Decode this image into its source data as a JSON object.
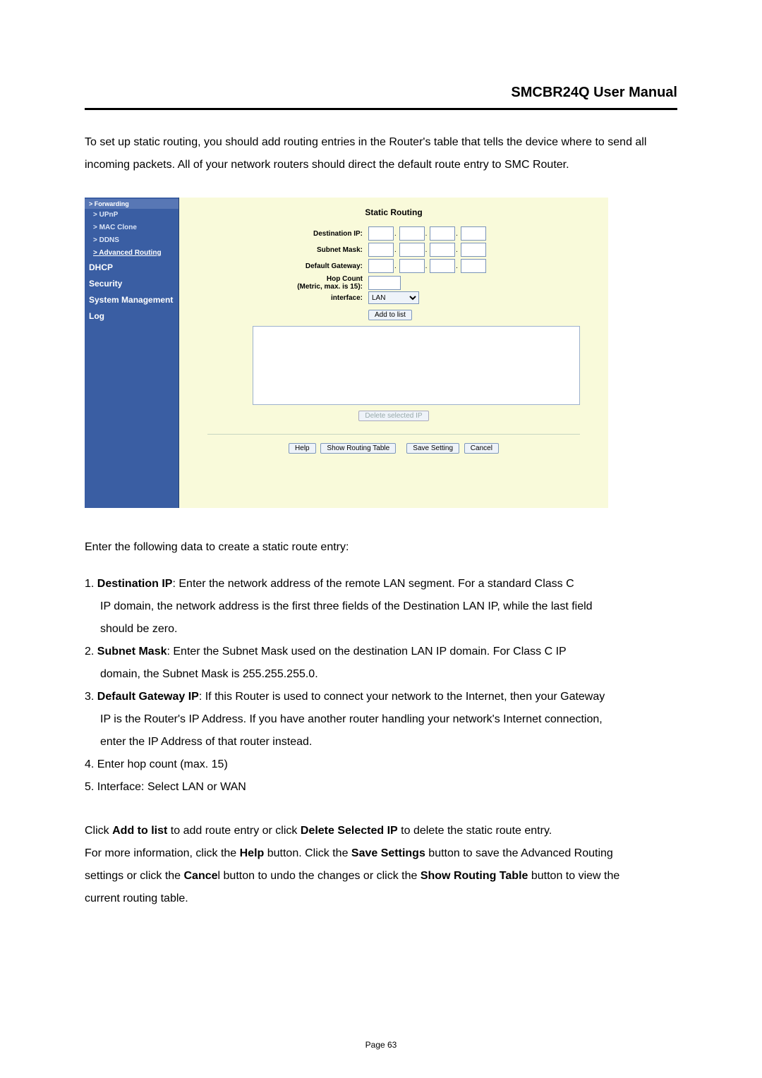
{
  "header": {
    "title": "SMCBR24Q User Manual"
  },
  "intro": "To set up static routing, you should add routing entries in the Router's table that tells the device where to send all incoming packets. All of your network routers should direct the default route entry to SMC Router.",
  "sidebar": {
    "topbar": "> Forwarding",
    "items": [
      {
        "label": "> UPnP",
        "kind": "indent"
      },
      {
        "label": "> MAC Clone",
        "kind": "indent"
      },
      {
        "label": "> DDNS",
        "kind": "indent"
      },
      {
        "label": "> Advanced Routing",
        "kind": "indent-link"
      },
      {
        "label": "DHCP",
        "kind": "section"
      },
      {
        "label": "Security",
        "kind": "section"
      },
      {
        "label": "System Management",
        "kind": "section"
      },
      {
        "label": "Log",
        "kind": "section"
      }
    ]
  },
  "pane": {
    "title": "Static Routing",
    "labels": {
      "dest_ip": "Destination IP:",
      "subnet": "Subnet Mask:",
      "gateway": "Default Gateway:",
      "hop": "Hop Count\n(Metric, max. is 15):",
      "interface": "interface:"
    },
    "interface_value": "LAN",
    "buttons": {
      "add": "Add to list",
      "delete": "Delete selected IP",
      "help": "Help",
      "show": "Show Routing Table",
      "save": "Save Setting",
      "cancel": "Cancel"
    }
  },
  "explain_lead": "Enter the following data to create a static route entry:",
  "steps": [
    {
      "num": "1.",
      "bold": "Destination IP",
      "tail": ": Enter the network address of the remote LAN segment. For a standard Class C",
      "cont": [
        "IP domain, the network address is the first three fields of the Destination LAN IP, while the last field",
        "should be zero."
      ]
    },
    {
      "num": "2.",
      "bold": "Subnet Mask",
      "tail": ": Enter the Subnet Mask used on the destination LAN IP domain. For Class C IP",
      "cont": [
        "domain, the Subnet Mask is 255.255.255.0."
      ]
    },
    {
      "num": "3.",
      "bold": "Default Gateway IP",
      "tail": ": If this Router is used to connect your network to the Internet, then your Gateway",
      "cont": [
        "IP is the Router's IP Address. If you have another router handling your network's Internet connection,",
        "enter the IP Address of that router instead."
      ]
    },
    {
      "num": "4.",
      "plain": "Enter hop count (max. 15)"
    },
    {
      "num": "5.",
      "plain": "Interface: Select LAN or WAN"
    }
  ],
  "footer": {
    "l1a": "Click ",
    "l1b": "Add to list",
    "l1c": " to add route entry or click ",
    "l1d": "Delete Selected IP",
    "l1e": " to delete the static route entry.",
    "l2a": "For more information, click the ",
    "l2b": "Help",
    "l2c": " button. Click the ",
    "l2d": "Save Settings",
    "l2e": " button to save the Advanced Routing",
    "l3a": "settings or click the ",
    "l3b": "Cance",
    "l3c": "l button to undo the changes or click the ",
    "l3d": "Show Routing Table",
    "l3e": " button to view the",
    "l4": "current routing table."
  },
  "page_number": "Page 63"
}
